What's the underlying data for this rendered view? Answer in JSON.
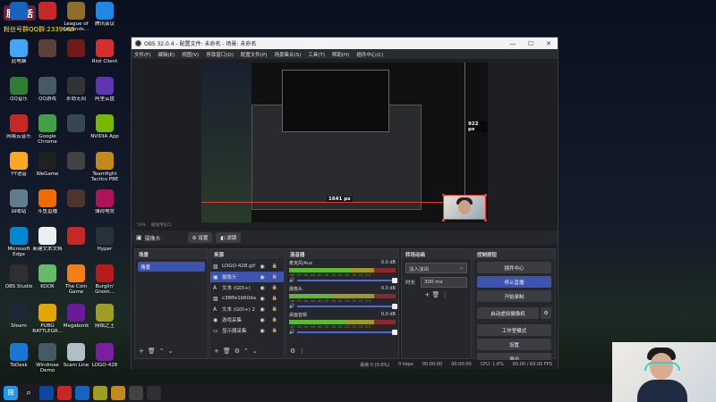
{
  "desktop": {
    "brand_overlay": "服务活",
    "qq_overlay": "粉丝号群QQ群:2339065",
    "icons": [
      {
        "label": "",
        "icon": "app-icon-1",
        "color": "#1565c0"
      },
      {
        "label": "",
        "icon": "app-icon-2",
        "color": "#c62828"
      },
      {
        "label": "League of Legends...",
        "icon": "league-icon",
        "color": "#8d6e2a"
      },
      {
        "label": "腾讯会议",
        "icon": "meeting-icon",
        "color": "#1e88e5"
      },
      {
        "label": "此电脑",
        "icon": "computer-icon",
        "color": "#42a5f5"
      },
      {
        "label": "",
        "icon": "game-icon-1",
        "color": "#5d4037"
      },
      {
        "label": "",
        "icon": "game-icon-2",
        "color": "#6d1b1b"
      },
      {
        "label": "Riot Client",
        "icon": "riot-icon",
        "color": "#d32f2f"
      },
      {
        "label": "QQ音乐",
        "icon": "qqmusic-icon",
        "color": "#2e7d32"
      },
      {
        "label": "QQ游戏",
        "icon": "qqgame-icon",
        "color": "#455a64"
      },
      {
        "label": "永劫无间",
        "icon": "game-icon-3",
        "color": "#333"
      },
      {
        "label": "阿里云盘",
        "icon": "aliyun-icon",
        "color": "#5e35b1"
      },
      {
        "label": "网易云音乐",
        "icon": "netease-icon",
        "color": "#c62828"
      },
      {
        "label": "Google Chrome",
        "icon": "chrome-icon",
        "color": "#43a047"
      },
      {
        "label": "",
        "icon": "game-icon-4",
        "color": "#37474f"
      },
      {
        "label": "NVIDIA App",
        "icon": "nvidia-icon",
        "color": "#76b900"
      },
      {
        "label": "YY语音",
        "icon": "yy-icon",
        "color": "#f9a825"
      },
      {
        "label": "WeGame",
        "icon": "wegame-icon",
        "color": "#212121"
      },
      {
        "label": "",
        "icon": "game-icon-5",
        "color": "#424242"
      },
      {
        "label": "Teamfight Tactics PBE",
        "icon": "tft-icon",
        "color": "#c28a1d"
      },
      {
        "label": "回收站",
        "icon": "recycle-icon",
        "color": "#607d8b"
      },
      {
        "label": "斗鱼直播",
        "icon": "douyu-icon",
        "color": "#ef6c00"
      },
      {
        "label": "",
        "icon": "game-icon-6",
        "color": "#4e342e"
      },
      {
        "label": "薄荷电竞",
        "icon": "mint-icon",
        "color": "#ad1457"
      },
      {
        "label": "Microsoft Edge",
        "icon": "edge-icon",
        "color": "#0288d1"
      },
      {
        "label": "新建文本文档",
        "icon": "text-icon",
        "color": "#eceff1"
      },
      {
        "label": "",
        "icon": "game-icon-7",
        "color": "#c62828"
      },
      {
        "label": "Hyper",
        "icon": "hyper-icon",
        "color": "#263238"
      },
      {
        "label": "OBS Studio",
        "icon": "obs-icon",
        "color": "#302e31"
      },
      {
        "label": "KOOK",
        "icon": "kook-icon",
        "color": "#66bb6a"
      },
      {
        "label": "The Coin Game",
        "icon": "coin-icon",
        "color": "#f57f17"
      },
      {
        "label": "Burglin' Gnom...",
        "icon": "gnome-icon",
        "color": "#b71c1c"
      },
      {
        "label": "Steam",
        "icon": "steam-icon",
        "color": "#1b2838"
      },
      {
        "label": "PUBG BATTLEGR...",
        "icon": "pubg-icon",
        "color": "#e0a800"
      },
      {
        "label": "Megabonk",
        "icon": "megabonk-icon",
        "color": "#6a1b9a"
      },
      {
        "label": "网络之王",
        "icon": "net-icon",
        "color": "#9e9d24"
      },
      {
        "label": "ToDesk",
        "icon": "todesk-icon",
        "color": "#1976d2"
      },
      {
        "label": "Windrose Demo",
        "icon": "windrose-icon",
        "color": "#455a64"
      },
      {
        "label": "Scam Line",
        "icon": "scam-icon",
        "color": "#b0bec5"
      },
      {
        "label": "LOGO-428",
        "icon": "logo-icon",
        "color": "#7b1fa2"
      }
    ]
  },
  "obs": {
    "title": "OBS 32.0.4 - 配置文件: 未命名 - 场景: 未命名",
    "menu": [
      "文件(F)",
      "编辑(E)",
      "视图(V)",
      "停靠窗口(D)",
      "配置文件(P)",
      "场景集合(S)",
      "工具(T)",
      "帮助(H)",
      "插件中心(C)"
    ],
    "measure_v": "922 px",
    "measure_h": "1641 px",
    "sub_left": "59%",
    "sub_mid": "播放预览口",
    "source_bar": {
      "name": "摄像头",
      "settings": "设置",
      "filters": "滤镜"
    },
    "scenes": {
      "title": "场景",
      "items": [
        "场景"
      ]
    },
    "sources": {
      "title": "来源",
      "items": [
        {
          "name": "LOGO-428.gif",
          "icon": "image-icon"
        },
        {
          "name": "摄像头",
          "icon": "camera-icon"
        },
        {
          "name": "文本 (GDI+)",
          "icon": "text-icon"
        },
        {
          "name": "c38ffe1b60da4970",
          "icon": "image-icon"
        },
        {
          "name": "文本 (GDI+) 2",
          "icon": "text-icon"
        },
        {
          "name": "游戏采集",
          "icon": "gamepad-icon"
        },
        {
          "name": "显示器采集",
          "icon": "monitor-icon"
        }
      ]
    },
    "mixer": {
      "title": "混音器",
      "channels": [
        {
          "name": "麦克风/Aux",
          "db": "0.0 dB",
          "level": 0.58
        },
        {
          "name": "摄像头",
          "db": "0.0 dB",
          "level": 0.4
        },
        {
          "name": "桌面音频",
          "db": "0.0 dB",
          "level": 0.52
        }
      ],
      "scale": "-60 -55 -50 -45 -40 -35 -30 -25 -20 -15 -10 -5 0"
    },
    "transitions": {
      "title": "转场动画",
      "type": "淡入淡出",
      "duration_label": "时长",
      "duration_value": "300 ms"
    },
    "controls": {
      "title": "控制按钮",
      "buttons": [
        "插件中心",
        "停止直播",
        "开始录制",
        "启动虚拟摄像机",
        "工作室模式",
        "设置",
        "退出"
      ]
    },
    "status": {
      "dropped": "丢帧 0 (0.0%)",
      "bitrate": "0 kbps",
      "stream_time": "00:00:00",
      "rec_time": "00:00:00",
      "cpu": "CPU: 1.6%",
      "fps": "60.00 / 60.00 FPS"
    }
  },
  "taskbar": {
    "items": [
      {
        "icon": "windows-icon",
        "glyph": "⊞",
        "color": "#2196f3"
      },
      {
        "icon": "search-icon",
        "glyph": "⌕",
        "color": "transparent"
      },
      {
        "icon": "app-icon-a",
        "glyph": "",
        "color": "#0d47a1"
      },
      {
        "icon": "app-icon-b",
        "glyph": "",
        "color": "#c62828"
      },
      {
        "icon": "app-icon-c",
        "glyph": "",
        "color": "#1565c0"
      },
      {
        "icon": "app-icon-d",
        "glyph": "",
        "color": "#9e9d24"
      },
      {
        "icon": "app-icon-e",
        "glyph": "",
        "color": "#c28a1d"
      },
      {
        "icon": "app-icon-f",
        "glyph": "",
        "color": "#424242"
      },
      {
        "icon": "obs-taskbar-icon",
        "glyph": "",
        "color": "#302e31"
      }
    ]
  }
}
